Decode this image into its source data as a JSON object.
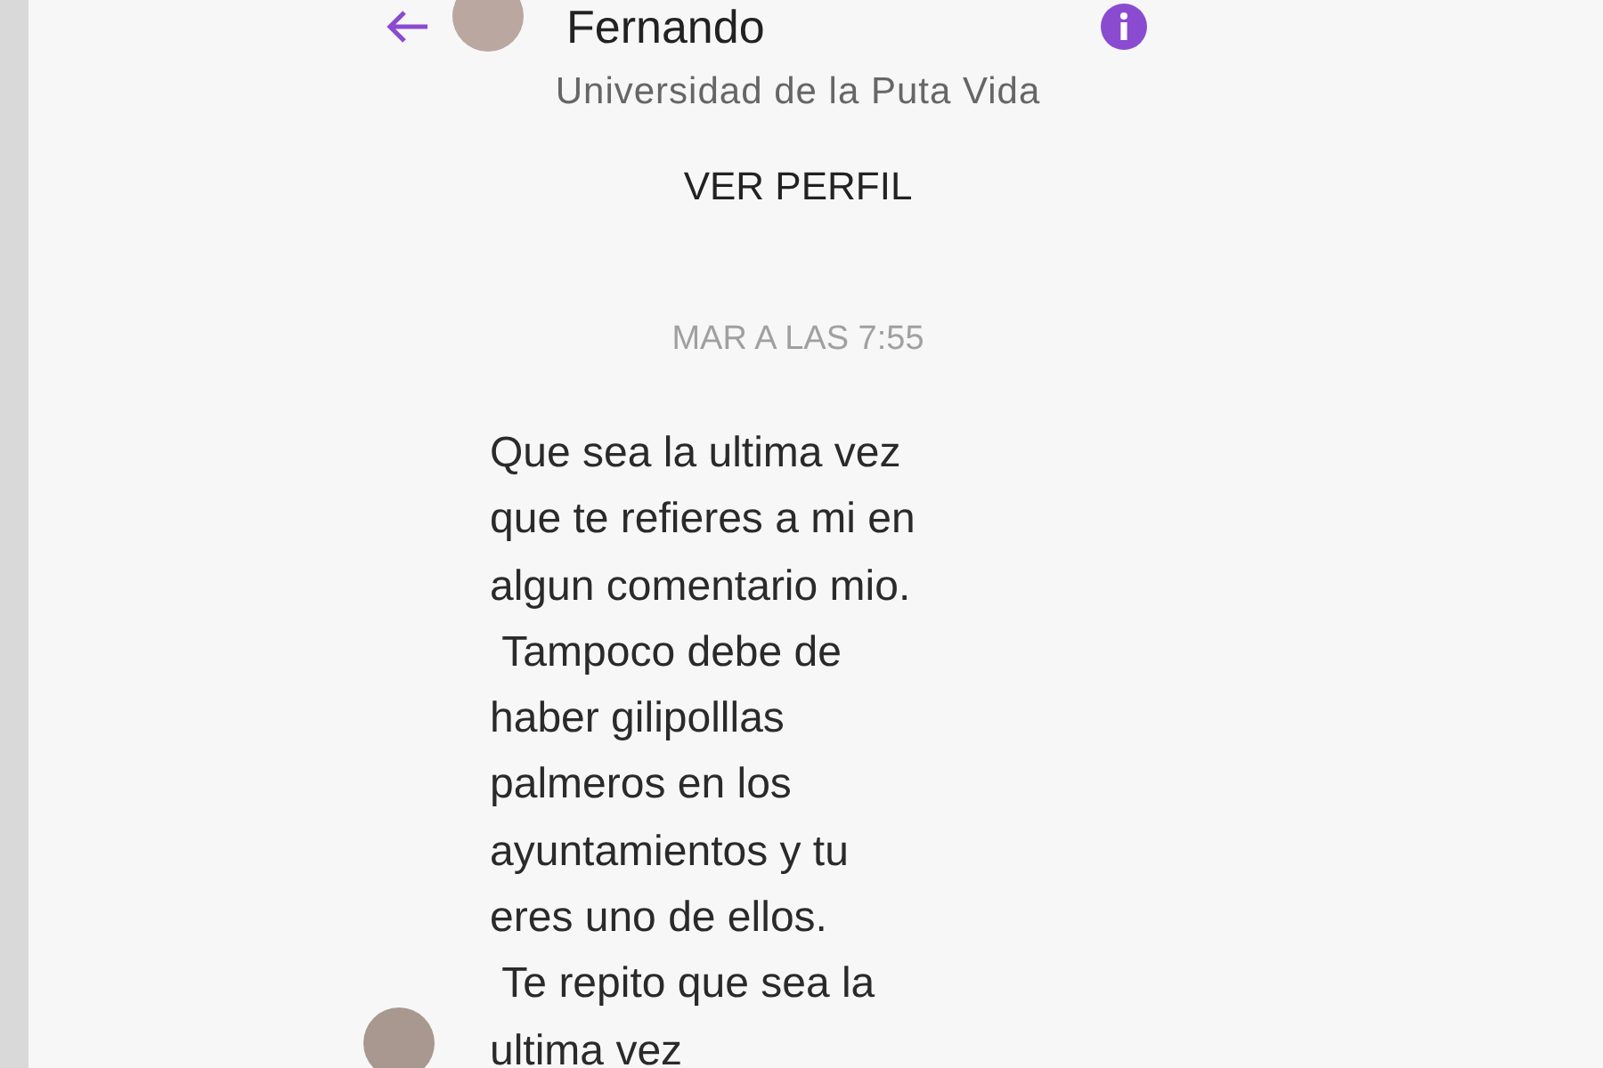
{
  "header": {
    "name": "Fernando",
    "subtitle": "Universidad de la Puta Vida",
    "profile_link": "VER PERFIL"
  },
  "timestamp": "MAR A LAS 7:55",
  "messages": [
    {
      "text": "Que sea la ultima vez\nque te refieres a mi en\nalgun comentario mio.\n Tampoco debe de\nhaber gilipolllas\npalmeros en los\nayuntamientos y tu\neres uno de ellos.\n Te repito que sea la\nultima vez"
    }
  ]
}
